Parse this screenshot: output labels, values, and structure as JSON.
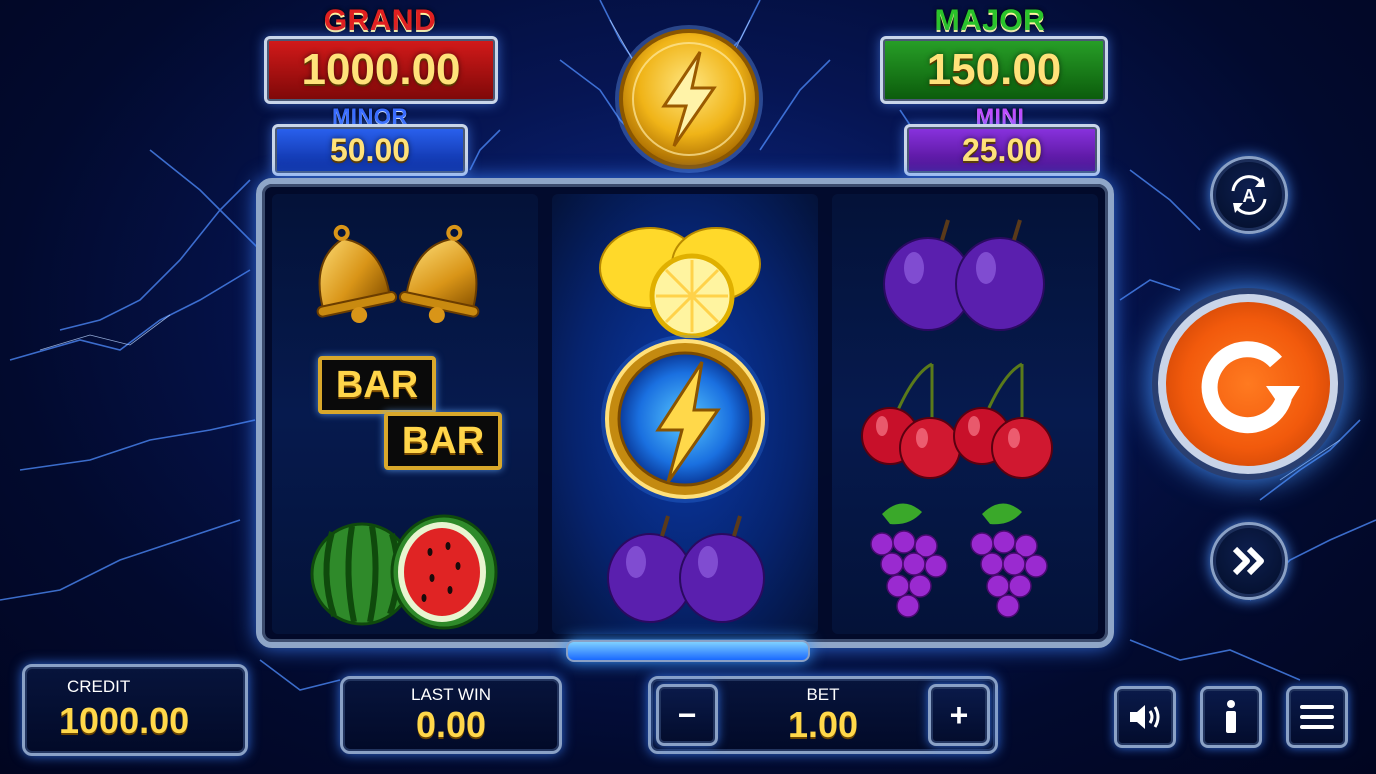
{
  "jackpots": {
    "grand": {
      "label": "GRAND",
      "value": "1000.00"
    },
    "major": {
      "label": "MAJOR",
      "value": "150.00"
    },
    "minor": {
      "label": "MINOR",
      "value": "50.00"
    },
    "mini": {
      "label": "MINI",
      "value": "25.00"
    }
  },
  "reels": {
    "left": {
      "symbols": [
        "bells-icon",
        "bar-bar-icon",
        "watermelon-icon"
      ],
      "bar_text": "BAR"
    },
    "middle": {
      "symbols": [
        "lemons-icon",
        "lightning-coin-icon",
        "plums-icon"
      ]
    },
    "right": {
      "symbols": [
        "plums-icon",
        "cherries-icon",
        "grapes-icon"
      ]
    }
  },
  "controls": {
    "autoplay_letter": "A",
    "plus": "+",
    "minus": "−"
  },
  "bottom": {
    "credit": {
      "label": "CREDIT",
      "value": "1000.00"
    },
    "last_win": {
      "label": "LAST WIN",
      "value": "0.00"
    },
    "bet": {
      "label": "BET",
      "value": "1.00"
    }
  },
  "colors": {
    "grand_box": "#b01212",
    "major_box": "#1f8a1f",
    "minor_box": "#1a4fd8",
    "mini_box": "#7a25c8",
    "spin": "#f25a0c",
    "value_gold": "#ffd84a"
  }
}
